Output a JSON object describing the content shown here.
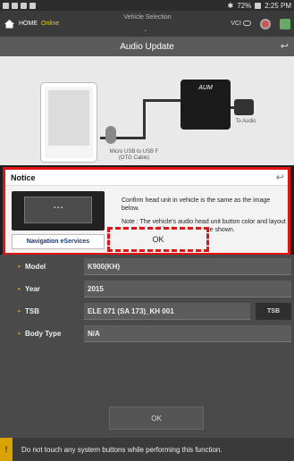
{
  "statusbar": {
    "battery": "72%",
    "time": "2:25 PM"
  },
  "topbar": {
    "home_label": "HOME",
    "online_label": "Online",
    "vehicle_selection_label": "Vehicle Selection",
    "vci_label": "VCI"
  },
  "title": "Audio Update",
  "diagram": {
    "aum_label": "AUM",
    "usb_label": "Micro USB to USB F",
    "otg_label": "(OTG Cable)",
    "to_audio_label": "To Audio"
  },
  "notice": {
    "title": "Notice",
    "message": "Confirm head unit in vehicle is the same as the image below.",
    "note": "Note : The vehicle's audio head unit button color and layout may slightly differ from the image shown.",
    "nav_button_label": "Navigation eServices",
    "ok_label": "OK"
  },
  "form": {
    "model": {
      "label": "Model",
      "value": "K900(KH)"
    },
    "year": {
      "label": "Year",
      "value": "2015"
    },
    "tsb": {
      "label": "TSB",
      "value": "ELE 071 (SA 173)_KH 001",
      "button_label": "TSB"
    },
    "body_type": {
      "label": "Body Type",
      "value": "N/A"
    },
    "ok_label": "OK"
  },
  "warning": {
    "text": "Do not touch any system buttons while performing this function."
  },
  "colors": {
    "highlight": "#e41212",
    "accent": "#d9a400",
    "online": "#d8d014"
  },
  "icons": [
    "home-icon",
    "back-arrow-icon",
    "vci-toggle-icon",
    "globe-icon",
    "warning-icon"
  ]
}
